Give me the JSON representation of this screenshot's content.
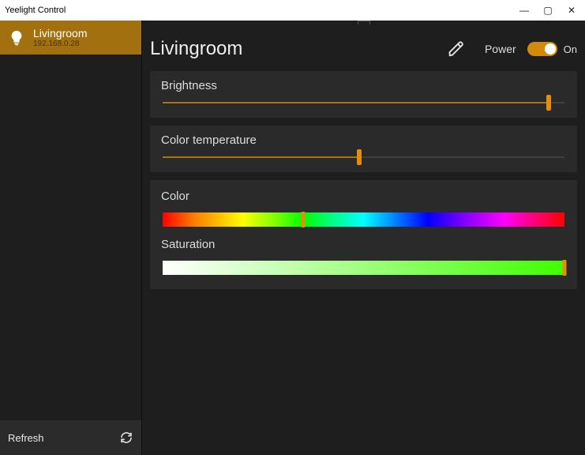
{
  "window": {
    "title": "Yeelight Control",
    "min": "—",
    "restore": "▢",
    "close": "✕"
  },
  "sidebar": {
    "devices": [
      {
        "name": "Livingroom",
        "ip": "192.168.0.28"
      }
    ],
    "refresh_label": "Refresh"
  },
  "colors": {
    "accent": "#e58e0b",
    "sidebar_selected": "#a2700e"
  },
  "detail": {
    "room_name": "Livingroom",
    "power_label": "Power",
    "power_state": "On",
    "brightness": {
      "label": "Brightness",
      "percent": 96
    },
    "color_temperature": {
      "label": "Color temperature",
      "percent": 49
    },
    "color": {
      "label": "Color",
      "hue_percent": 35,
      "hue_color": "#40ff00"
    },
    "saturation": {
      "label": "Saturation",
      "percent": 100
    }
  }
}
